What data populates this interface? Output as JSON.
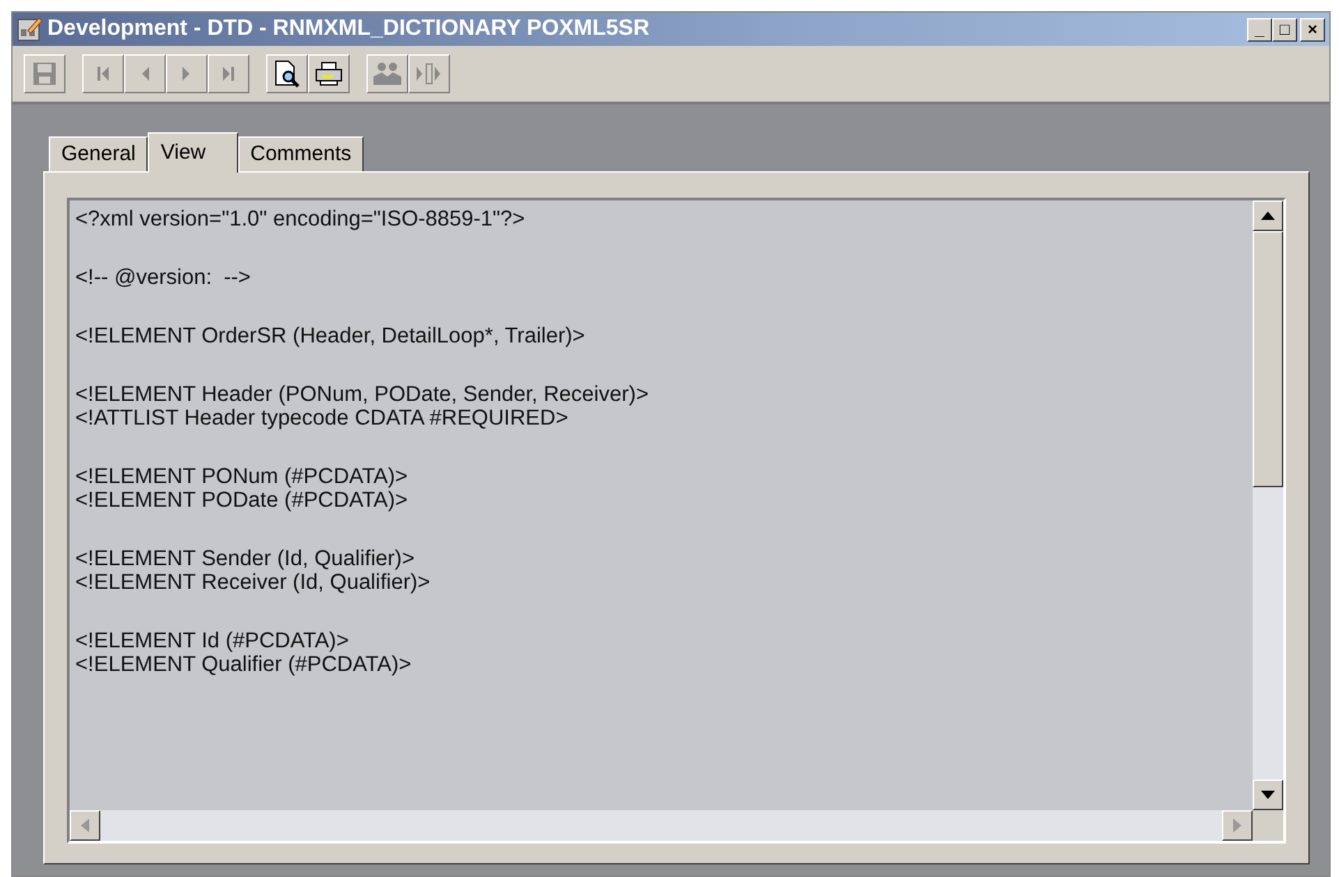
{
  "window": {
    "title": "Development - DTD - RNMXML_DICTIONARY  POXML5SR",
    "controls": [
      "_",
      "□",
      "×"
    ]
  },
  "toolbar": [
    {
      "kind": "save",
      "disabled": true
    },
    {
      "kind": "first",
      "disabled": true
    },
    {
      "kind": "prev",
      "disabled": true
    },
    {
      "kind": "next",
      "disabled": true
    },
    {
      "kind": "last",
      "disabled": true
    },
    {
      "kind": "preview",
      "disabled": false
    },
    {
      "kind": "print",
      "disabled": false
    },
    {
      "kind": "people",
      "disabled": true
    },
    {
      "kind": "split",
      "disabled": true
    }
  ],
  "tabs": [
    {
      "label": "General",
      "selected": false
    },
    {
      "label": "View",
      "selected": true
    },
    {
      "label": "Comments",
      "selected": false
    }
  ],
  "code_blocks": [
    [
      "<?xml version=\"1.0\" encoding=\"ISO-8859-1\"?>"
    ],
    [
      "<!-- @version:  -->"
    ],
    [
      "<!ELEMENT OrderSR (Header, DetailLoop*, Trailer)>"
    ],
    [
      "<!ELEMENT Header (PONum, PODate, Sender, Receiver)>",
      "<!ATTLIST Header typecode CDATA #REQUIRED>"
    ],
    [
      "<!ELEMENT PONum (#PCDATA)>",
      "<!ELEMENT PODate (#PCDATA)>"
    ],
    [
      "<!ELEMENT Sender (Id, Qualifier)>",
      "<!ELEMENT Receiver (Id, Qualifier)>"
    ],
    [
      "<!ELEMENT Id (#PCDATA)>",
      "<!ELEMENT Qualifier (#PCDATA)>"
    ]
  ]
}
